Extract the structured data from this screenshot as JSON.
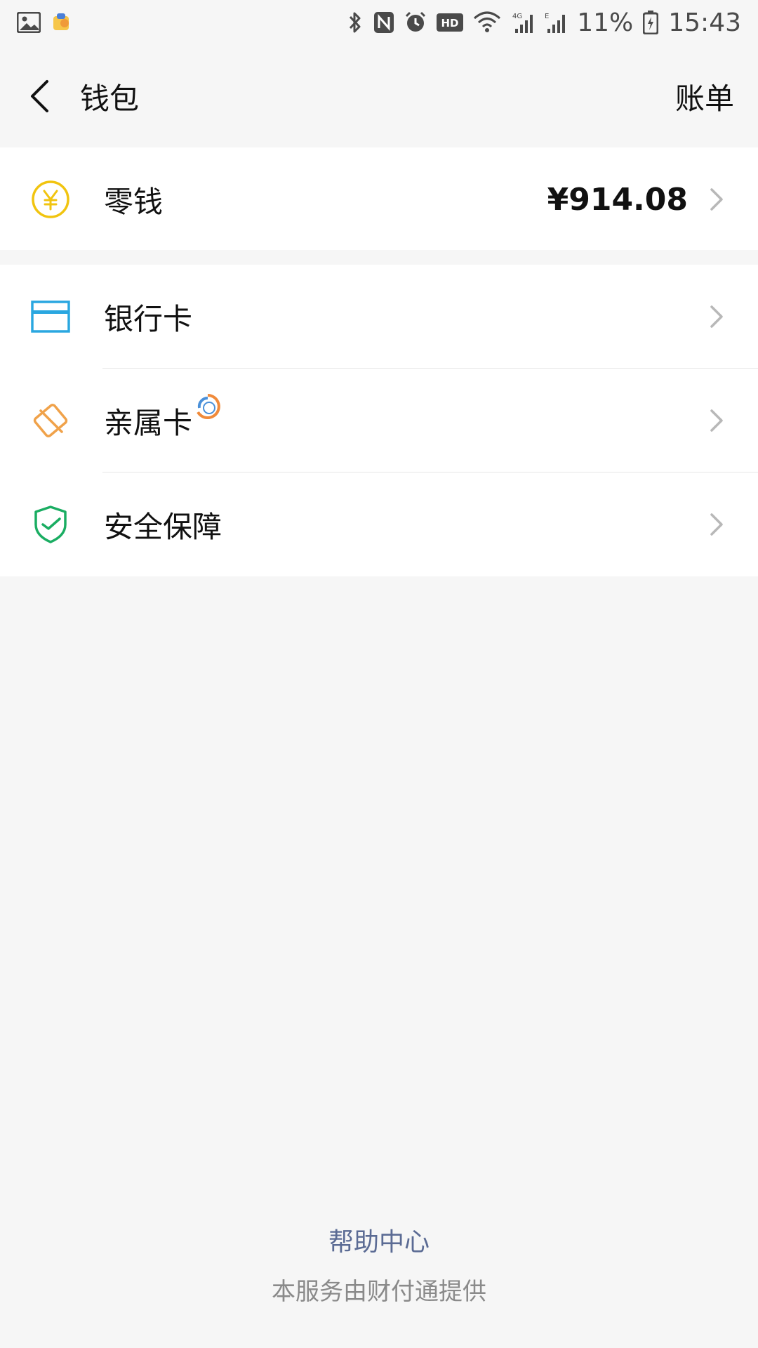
{
  "status_bar": {
    "battery_percent": "11%",
    "time": "15:43",
    "hd_label": "HD",
    "net_4g": "4G",
    "net_e": "E"
  },
  "header": {
    "title": "钱包",
    "bill_label": "账单"
  },
  "items": {
    "change": {
      "label": "零钱",
      "value": "¥914.08"
    },
    "bank_card": {
      "label": "银行卡"
    },
    "family_card": {
      "label": "亲属卡"
    },
    "security": {
      "label": "安全保障"
    }
  },
  "footer": {
    "help": "帮助中心",
    "provider": "本服务由财付通提供"
  },
  "colors": {
    "coin": "#f1c40f",
    "bank": "#2aa7e0",
    "family": "#f0a24a",
    "shield": "#1aad62",
    "link": "#5b6b94"
  },
  "icons": {
    "coin": "yuan-coin-icon",
    "bank": "bank-card-icon",
    "family": "family-card-icon",
    "shield": "shield-check-icon",
    "chevron": "chevron-right-icon",
    "back": "back-arrow-icon"
  }
}
